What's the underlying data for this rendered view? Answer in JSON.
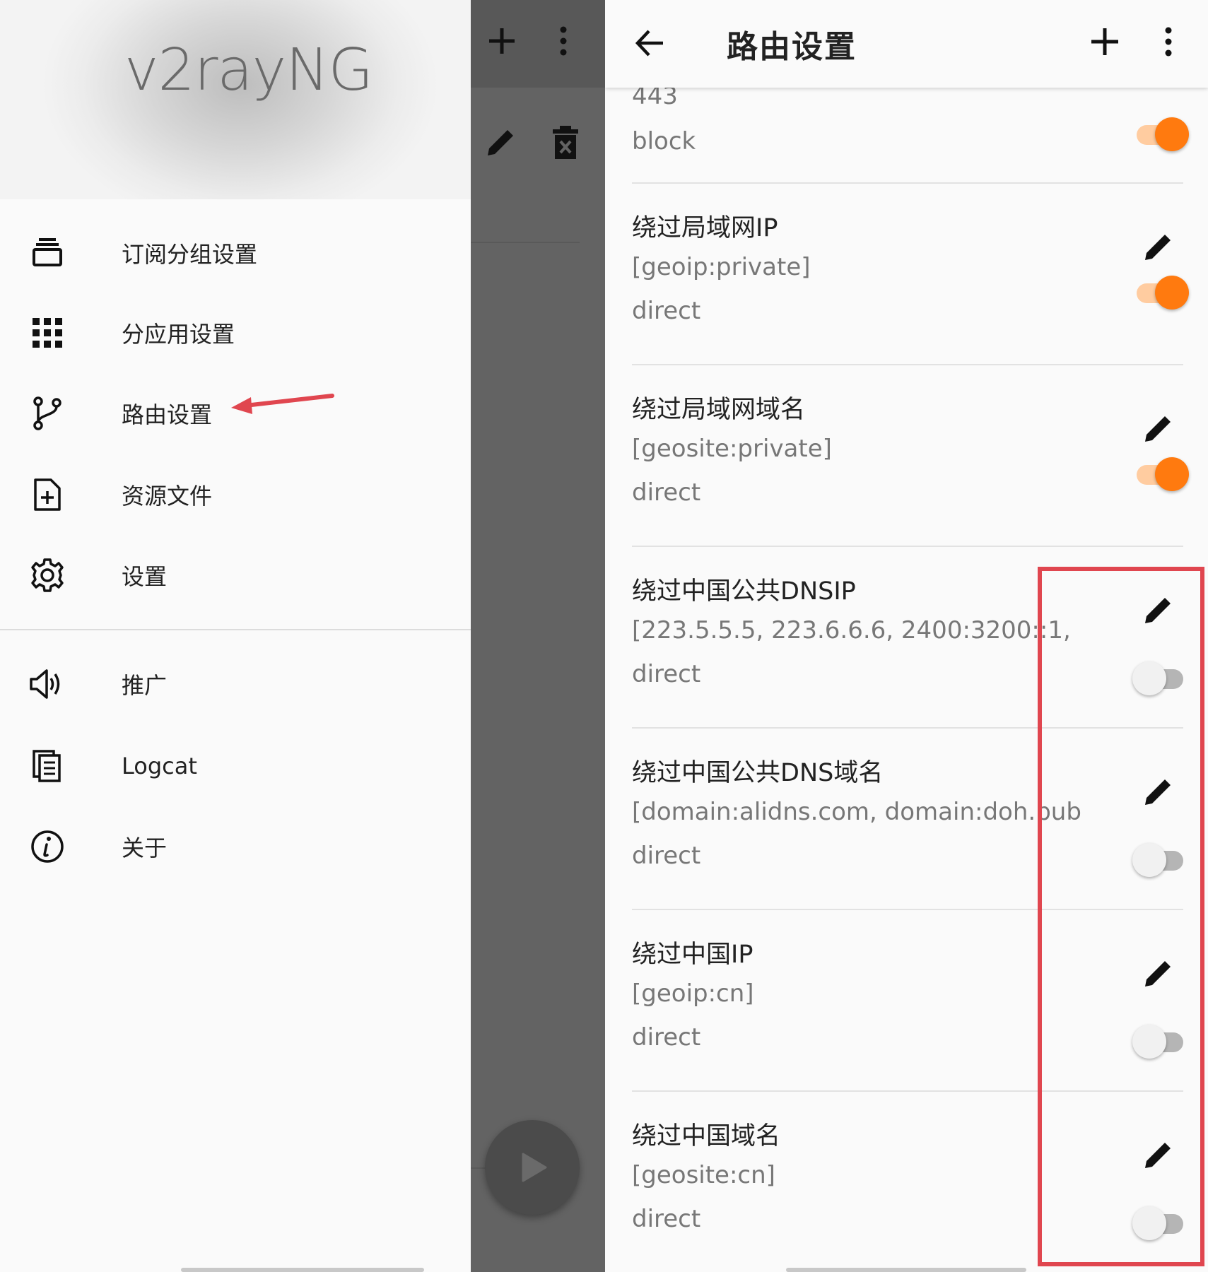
{
  "drawer": {
    "app_name": "v2rayNG",
    "items": [
      {
        "label": "订阅分组设置",
        "icon": "subscription-group-icon"
      },
      {
        "label": "分应用设置",
        "icon": "apps-grid-icon"
      },
      {
        "label": "路由设置",
        "icon": "routing-branch-icon"
      },
      {
        "label": "资源文件",
        "icon": "file-add-icon"
      },
      {
        "label": "设置",
        "icon": "gear-icon"
      },
      {
        "label": "推广",
        "icon": "speaker-icon"
      },
      {
        "label": "Logcat",
        "icon": "logcat-document-icon"
      },
      {
        "label": "关于",
        "icon": "info-icon"
      }
    ]
  },
  "routing": {
    "title": "路由设置",
    "partial_rule": {
      "port": "443",
      "outbound": "block",
      "enabled": true
    },
    "rules": [
      {
        "name": "绕过局域网IP",
        "domain": "[geoip:private]",
        "outbound": "direct",
        "enabled": true
      },
      {
        "name": "绕过局域网域名",
        "domain": "[geosite:private]",
        "outbound": "direct",
        "enabled": true
      },
      {
        "name": "绕过中国公共DNSIP",
        "domain": "[223.5.5.5, 223.6.6.6, 2400:3200::1,",
        "outbound": "direct",
        "enabled": false
      },
      {
        "name": "绕过中国公共DNS域名",
        "domain": "[domain:alidns.com, domain:doh.pub",
        "outbound": "direct",
        "enabled": false
      },
      {
        "name": "绕过中国IP",
        "domain": "[geoip:cn]",
        "outbound": "direct",
        "enabled": false
      },
      {
        "name": "绕过中国域名",
        "domain": "[geosite:cn]",
        "outbound": "direct",
        "enabled": false
      }
    ]
  },
  "colors": {
    "accent": "#ff7a0f",
    "highlight_box": "#e0464f",
    "annotation_arrow": "#e0464f"
  }
}
